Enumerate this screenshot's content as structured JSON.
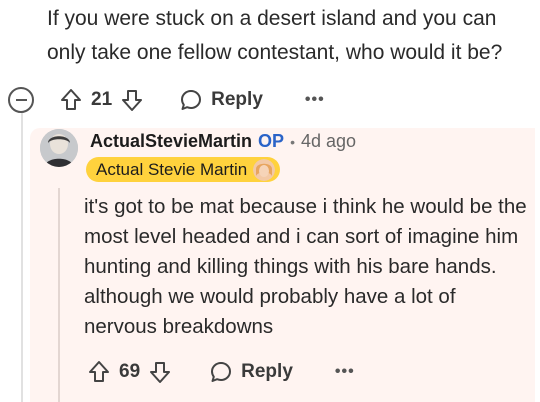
{
  "parent_comment": {
    "text": "If you were stuck on a desert island and you can only take one fellow contestant, who would it be?",
    "votes": "21",
    "reply_label": "Reply",
    "more_label": "•••"
  },
  "reply": {
    "username": "ActualStevieMartin",
    "op_badge": "OP",
    "separator": "•",
    "age": "4d ago",
    "flair": "Actual Stevie Martin",
    "text": "it's got to be mat because i think he would be the most level headed and i can sort of imagine him hunting and killing things with his bare hands. although we would probably have a lot of nervous breakdowns",
    "votes": "69",
    "reply_label": "Reply",
    "more_label": "•••"
  },
  "colors": {
    "op_blue": "#2b64c8",
    "flair_yellow": "#ffd23d",
    "reply_background": "#fff4f1"
  },
  "icons": [
    "collapse-icon",
    "upvote-icon",
    "downvote-icon",
    "comment-bubble-icon",
    "more-icon"
  ]
}
